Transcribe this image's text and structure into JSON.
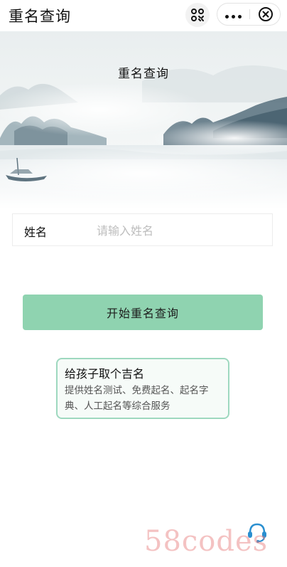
{
  "header": {
    "app_title": "重名查询",
    "icons": [
      "qr-scan-icon",
      "more-dots-icon",
      "close-circle-icon"
    ]
  },
  "banner": {
    "title": "重名查询"
  },
  "form": {
    "name_label": "姓名",
    "name_placeholder": "请输入姓名",
    "name_value": ""
  },
  "actions": {
    "search_label": "开始重名查询"
  },
  "promo": {
    "title": "给孩子取个吉名",
    "description": "提供姓名测试、免费起名、起名字典、人工起名等综合服务"
  },
  "support": {
    "icon": "customer-service-icon"
  },
  "watermark": {
    "text": "58codes"
  },
  "colors": {
    "accent": "#8fd3b0",
    "promo_border": "#9ed8bf",
    "placeholder": "#bdbdbd",
    "watermark": "#e67878"
  }
}
